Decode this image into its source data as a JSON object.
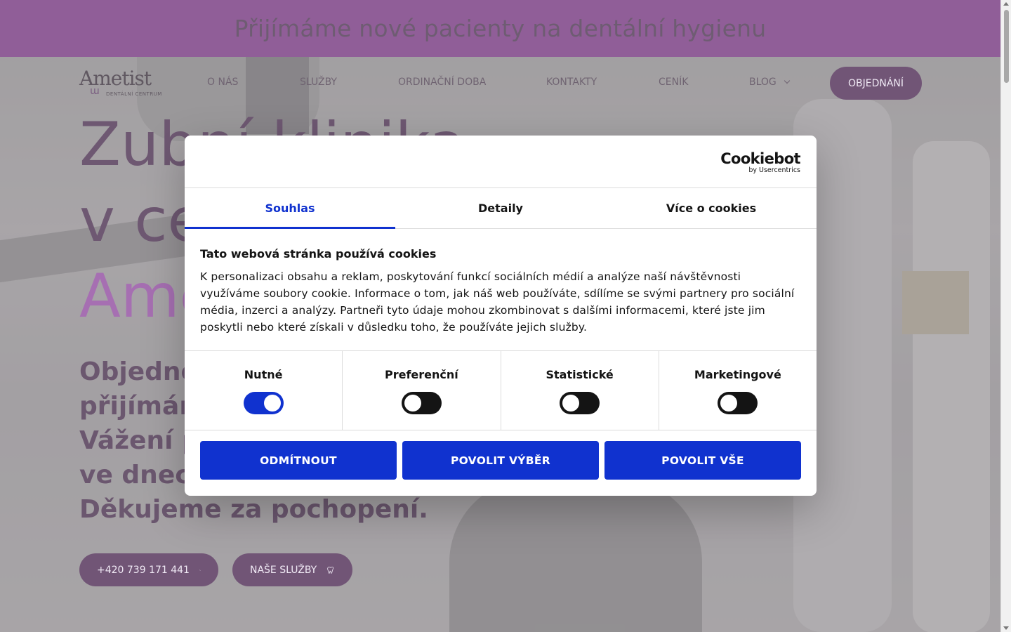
{
  "announcement": "Přijímáme nové pacienty na dentální hygienu",
  "logo": {
    "brand": "Ametist",
    "subtitle": "DENTÁLNÍ CENTRUM"
  },
  "nav": {
    "items": [
      "O NÁS",
      "SLUŽBY",
      "ORDINAČNÍ DOBA",
      "KONTAKTY",
      "CENÍK",
      "BLOG"
    ],
    "order_button": "OBJEDNÁNÍ"
  },
  "hero": {
    "line1": "Zubní klinika",
    "line2": "v centru",
    "line3": "Ametist",
    "sub1": "Objednejte se",
    "sub2": "přijímáme",
    "sub3": "Vážení p",
    "sub4": "ve dnech",
    "sub5": "Děkujeme za pochopení.",
    "phone_button": "+420 739 171 441",
    "services_button": "NAŠE SLUŽBY"
  },
  "cookie": {
    "logo_name": "Cookiebot",
    "logo_by": "by Usercentrics",
    "tabs": [
      "Souhlas",
      "Detaily",
      "Více o cookies"
    ],
    "heading": "Tato webová stránka používá cookies",
    "text": "K personalizaci obsahu a reklam, poskytování funkcí sociálních médií a analýze naší návštěvnosti využíváme soubory cookie. Informace o tom, jak náš web používáte, sdílíme se svými partnery pro sociální média, inzerci a analýzy. Partneři tyto údaje mohou zkombinovat s dalšími informacemi, které jste jim poskytli nebo které získali v důsledku toho, že používáte jejich služby.",
    "toggles": [
      {
        "label": "Nutné",
        "on": true
      },
      {
        "label": "Preferenční",
        "on": false
      },
      {
        "label": "Statistické",
        "on": false
      },
      {
        "label": "Marketingové",
        "on": false
      }
    ],
    "buttons": {
      "decline": "ODMÍTNOUT",
      "allow_selection": "POVOLIT VÝBĚR",
      "allow_all": "POVOLIT VŠE"
    }
  },
  "colors": {
    "brand_purple": "#5c1367",
    "dark_purple": "#2e0535",
    "accent_violet": "#7d2c8e",
    "cookie_blue": "#1032cf"
  }
}
